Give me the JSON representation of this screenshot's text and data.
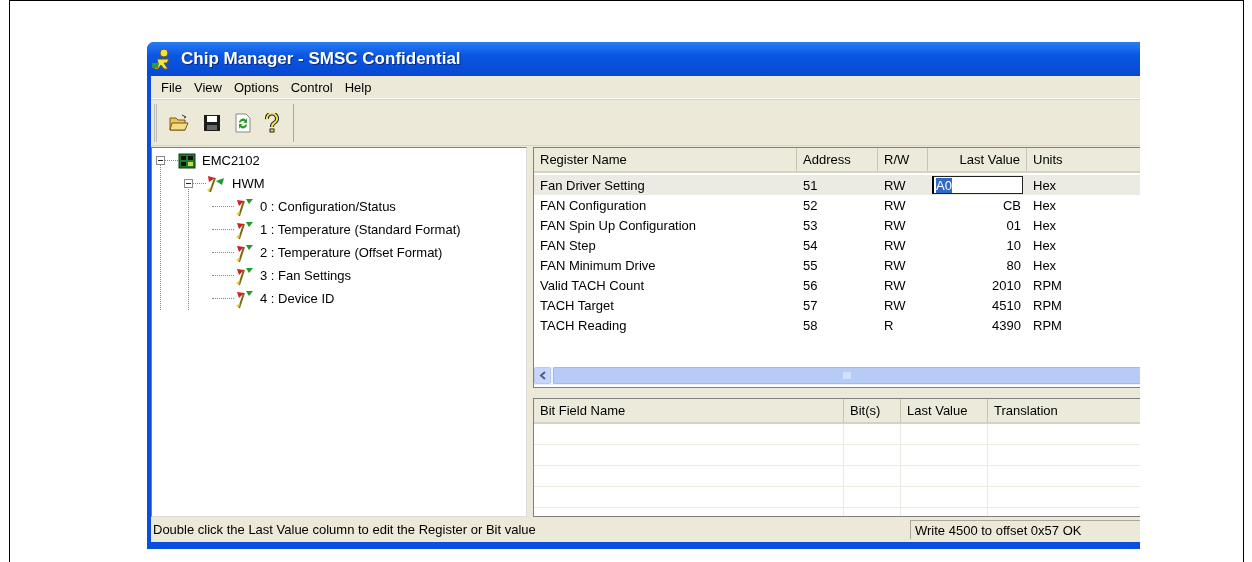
{
  "window": {
    "title": "Chip Manager - SMSC Confidential"
  },
  "menu": [
    "File",
    "View",
    "Options",
    "Control",
    "Help"
  ],
  "toolbar": [
    {
      "kind": "open"
    },
    {
      "kind": "save"
    },
    {
      "kind": "refresh"
    },
    {
      "kind": "help"
    }
  ],
  "tree": [
    {
      "label": "EMC2102",
      "kind": "chip",
      "expanded": true,
      "children": [
        {
          "label": "HWM",
          "kind": "group",
          "expanded": true,
          "children": [
            {
              "label": "0 : Configuration/Status",
              "kind": "register"
            },
            {
              "label": "1 : Temperature (Standard Format)",
              "kind": "register"
            },
            {
              "label": "2 : Temperature (Offset Format)",
              "kind": "register"
            },
            {
              "label": "3 : Fan Settings",
              "kind": "register"
            },
            {
              "label": "4 : Device ID",
              "kind": "register"
            }
          ]
        }
      ]
    }
  ],
  "register_table": {
    "columns": [
      "Register Name",
      "Address",
      "R/W",
      "Last Value",
      "Units"
    ],
    "rows": [
      {
        "cells": [
          "Fan Driver Setting",
          "51",
          "RW",
          "A0",
          "Hex"
        ],
        "selected": true,
        "editing": true
      },
      {
        "cells": [
          "FAN Configuration",
          "52",
          "RW",
          "CB",
          "Hex"
        ],
        "selected": false,
        "editing": false
      },
      {
        "cells": [
          "FAN Spin Up Configuration",
          "53",
          "RW",
          "01",
          "Hex"
        ],
        "selected": false,
        "editing": false
      },
      {
        "cells": [
          "FAN Step",
          "54",
          "RW",
          "10",
          "Hex"
        ],
        "selected": false,
        "editing": false
      },
      {
        "cells": [
          "FAN Minimum Drive",
          "55",
          "RW",
          "80",
          "Hex"
        ],
        "selected": false,
        "editing": false
      },
      {
        "cells": [
          "Valid TACH Count",
          "56",
          "RW",
          "2010",
          "RPM"
        ],
        "selected": false,
        "editing": false
      },
      {
        "cells": [
          "TACH Target",
          "57",
          "RW",
          "4510",
          "RPM"
        ],
        "selected": false,
        "editing": false
      },
      {
        "cells": [
          "TACH Reading",
          "58",
          "R",
          "4390",
          "RPM"
        ],
        "selected": false,
        "editing": false
      }
    ]
  },
  "bit_table": {
    "columns": [
      "Bit Field Name",
      "Bit(s)",
      "Last Value",
      "Translation"
    ]
  },
  "status_bar": {
    "message": "Double click the Last Value column to edit the Register or Bit value",
    "result": "Write 4500 to offset 0x57 OK"
  }
}
